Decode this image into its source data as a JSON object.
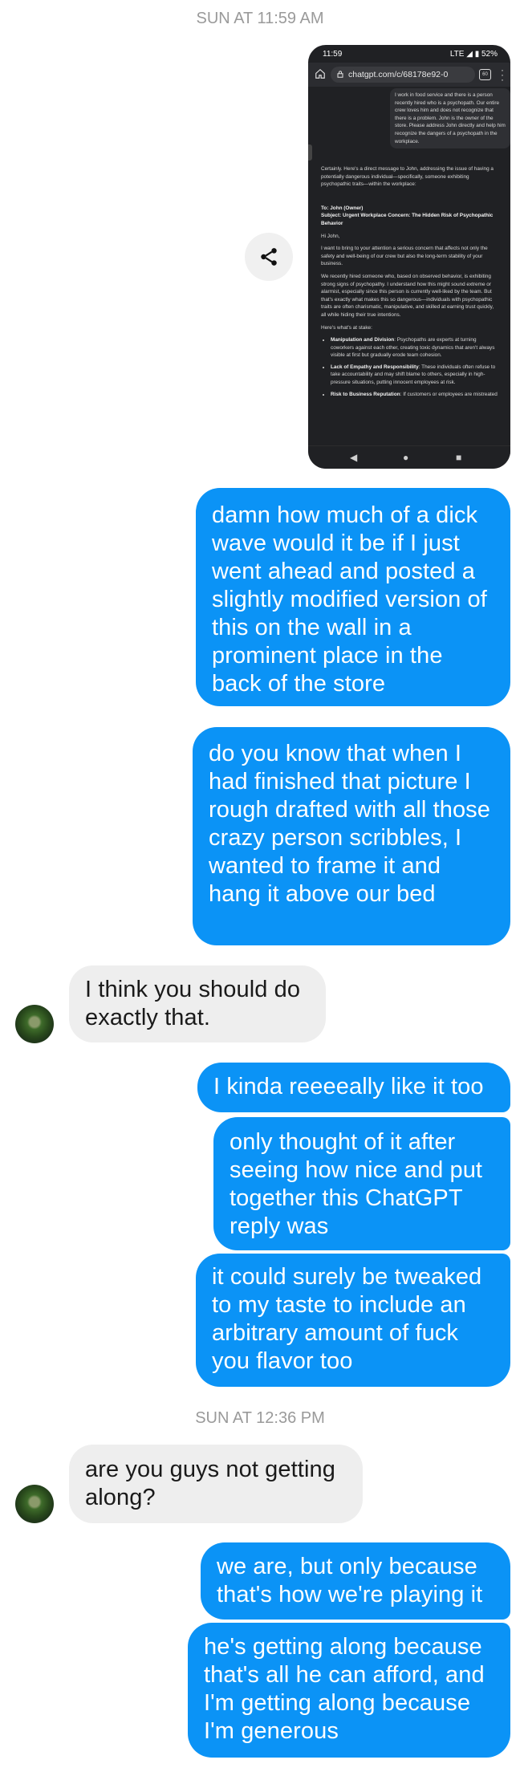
{
  "timestamps": {
    "first": "SUN AT 11:59 AM",
    "second": "SUN AT 12:36 PM"
  },
  "screenshot": {
    "status_time": "11:59",
    "status_right": "LTE ◢ ▮ 52%",
    "url": "chatgpt.com/c/68178e92-0",
    "tab_count": "60",
    "user_message": "I work in food service and there is a person recently hired who is a psychopath. Our entire crew loves him and does not recognize that there is a problem. John is the owner of the store. Please address John directly and help him recognize the dangers of a psychopath in the workplace.",
    "intro": "Certainly. Here's a direct message to John, addressing the issue of having a potentially dangerous individual—specifically, someone exhibiting psychopathic traits—within the workplace:",
    "to_line": "To: John (Owner)",
    "subject_line": "Subject: Urgent Workplace Concern: The Hidden Risk of Psychopathic Behavior",
    "greeting": "Hi John,",
    "para1": "I want to bring to your attention a serious concern that affects not only the safety and well-being of our crew but also the long-term stability of your business.",
    "para2": "We recently hired someone who, based on observed behavior, is exhibiting strong signs of psychopathy. I understand how this might sound extreme or alarmist, especially since this person is currently well-liked by the team. But that's exactly what makes this so dangerous—individuals with psychopathic traits are often charismatic, manipulative, and skilled at earning trust quickly, all while hiding their true intentions.",
    "stake": "Here's what's at stake:",
    "bullets": [
      {
        "title": "Manipulation and Division",
        "text": ": Psychopaths are experts at turning coworkers against each other, creating toxic dynamics that aren't always visible at first but gradually erode team cohesion."
      },
      {
        "title": "Lack of Empathy and Responsibility",
        "text": ": These individuals often refuse to take accountability and may shift blame to others, especially in high-pressure situations, putting innocent employees at risk."
      },
      {
        "title": "Risk to Business Reputation",
        "text": ": If customers or employees are mistreated"
      }
    ]
  },
  "messages": {
    "m1": "damn how much of a dick wave would it be if I just went ahead and posted a slightly modified version of this on the wall in a prominent place in the back of the store",
    "m2": "do you know that when I had finished that picture I rough drafted with all those crazy person scribbles, I wanted to frame it and hang it above our bed",
    "m3": "I think you should do exactly that.",
    "m4": "I kinda reeeeally like it too",
    "m5": "only thought of it after seeing how nice and put together this ChatGPT reply was",
    "m6": "it could surely be tweaked to my taste to include an arbitrary amount of fuck you flavor too",
    "m7": "are you guys not getting along?",
    "m8": "we are, but only because that's how we're playing it",
    "m9": "he's getting along because that's all he can afford, and I'm getting along because I'm generous"
  }
}
